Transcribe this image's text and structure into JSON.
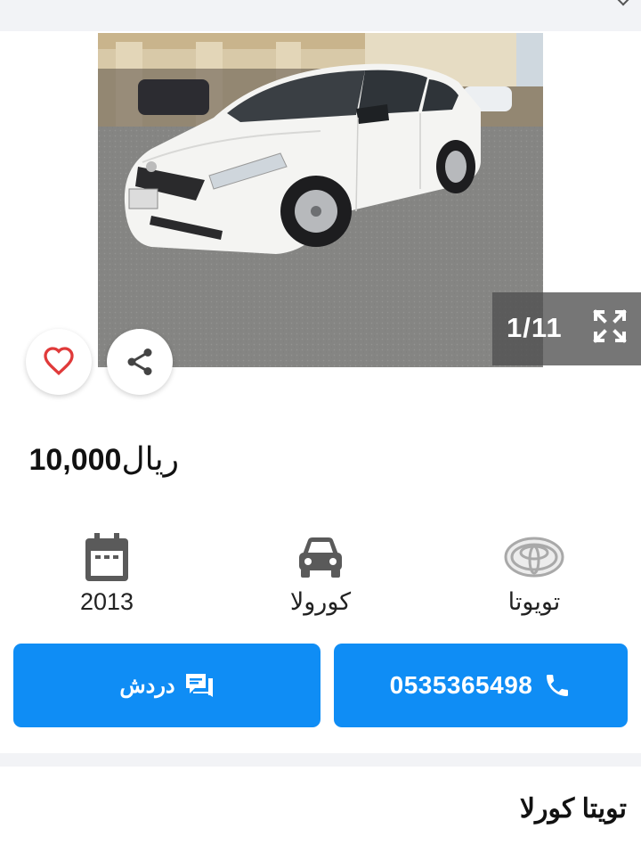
{
  "gallery": {
    "counter": "1/11",
    "current_index": 1,
    "total_images": 11
  },
  "icons": {
    "prev": "chevron-left-icon",
    "next": "chevron-right-icon",
    "expand": "expand-icon",
    "favorite": "heart-icon",
    "share": "share-icon",
    "year": "calendar-icon",
    "model": "car-icon",
    "make": "toyota-logo-icon",
    "chat": "chat-icon",
    "call": "phone-icon"
  },
  "price": {
    "amount": "10,000",
    "currency": "ريال"
  },
  "specs": {
    "year": "2013",
    "model": "كورولا",
    "make": "تويوتا"
  },
  "actions": {
    "chat_label": "دردش",
    "phone_number": "0535365498"
  },
  "listing": {
    "title": "تويتا كورلا"
  },
  "colors": {
    "accent": "#0f8df5",
    "favorite": "#e03a3a",
    "icon_gray": "#5a5a5a",
    "band": "#f2f3f6"
  }
}
